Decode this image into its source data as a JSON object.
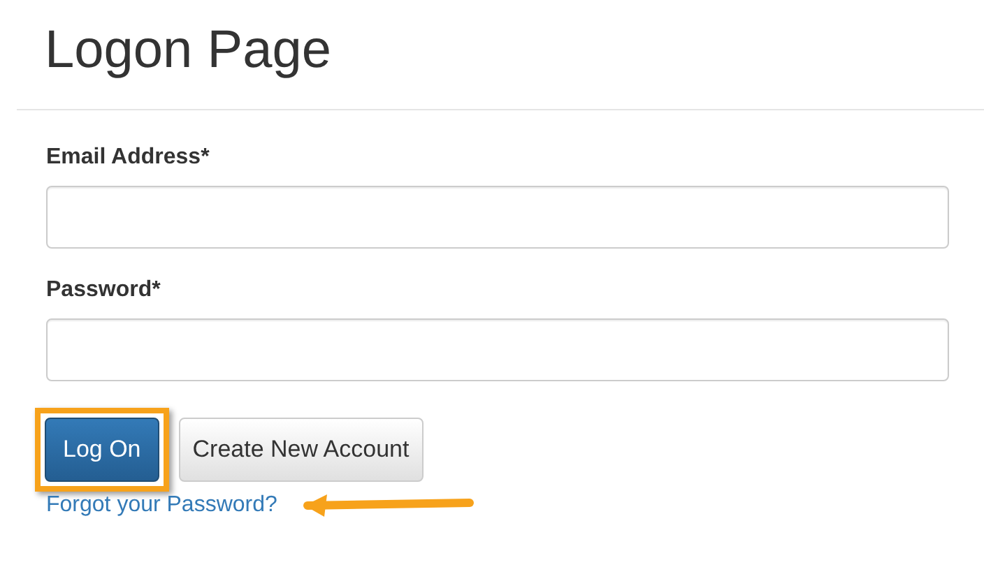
{
  "title": "Logon Page",
  "fields": [
    {
      "label": "Email Address*"
    },
    {
      "label": "Password*"
    }
  ],
  "buttons": [
    {
      "label": "Log On",
      "kind": "primary",
      "highlighted": true
    },
    {
      "label": "Create New Account",
      "kind": "default",
      "highlighted": false
    }
  ],
  "forgot_link": {
    "label": "Forgot your Password?",
    "pointed_at": true
  }
}
